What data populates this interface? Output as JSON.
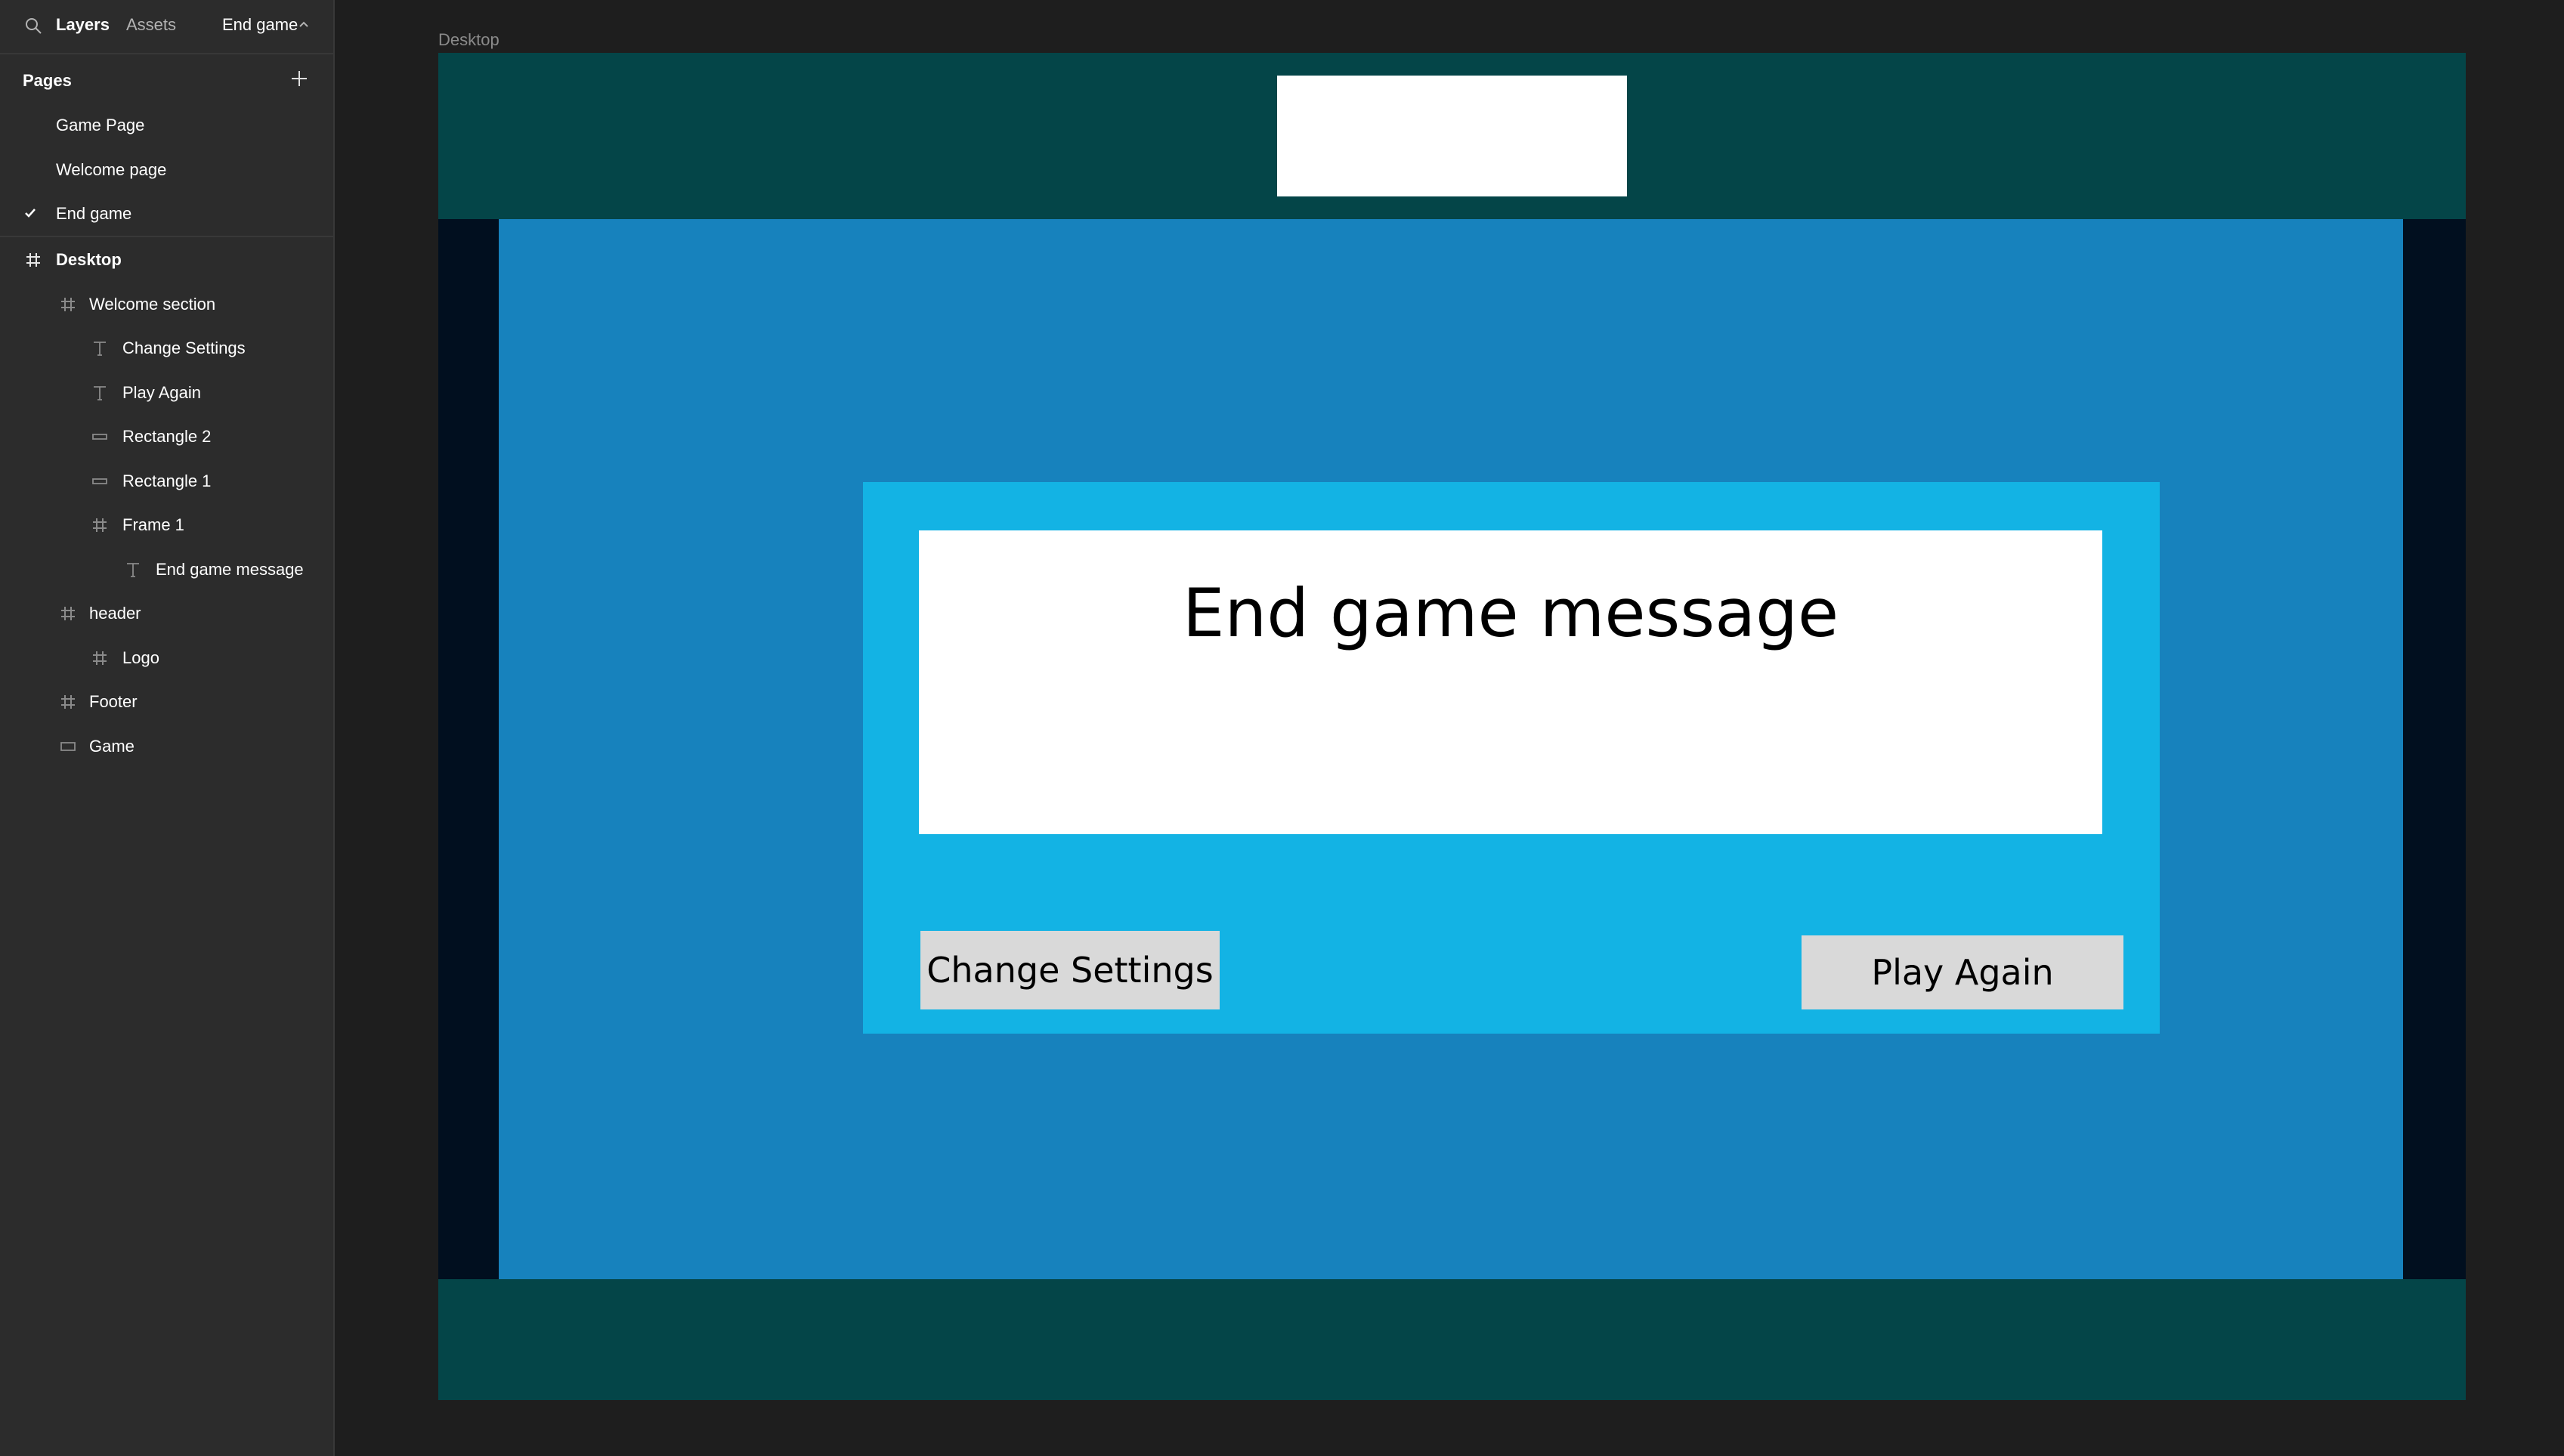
{
  "sidebar": {
    "tabs": {
      "layers": "Layers",
      "assets": "Assets"
    },
    "current_page": "End game",
    "pages_header": "Pages",
    "pages": [
      "Game Page",
      "Welcome page",
      "End game"
    ],
    "layers": [
      "Desktop",
      "Welcome section",
      "Change Settings",
      "Play Again",
      "Rectangle 2",
      "Rectangle 1",
      "Frame 1",
      "End game message",
      "header",
      "Logo",
      "Footer",
      "Game"
    ]
  },
  "canvas": {
    "frame_label": "Desktop",
    "end_message": "End game message",
    "change_settings_label": "Change Settings",
    "play_again_label": "Play Again"
  },
  "colors": {
    "header_footer": "#044548",
    "game_bg": "#1782bd",
    "welcome_bg": "#13b3e4",
    "desktop_bg": "#010f1f"
  }
}
